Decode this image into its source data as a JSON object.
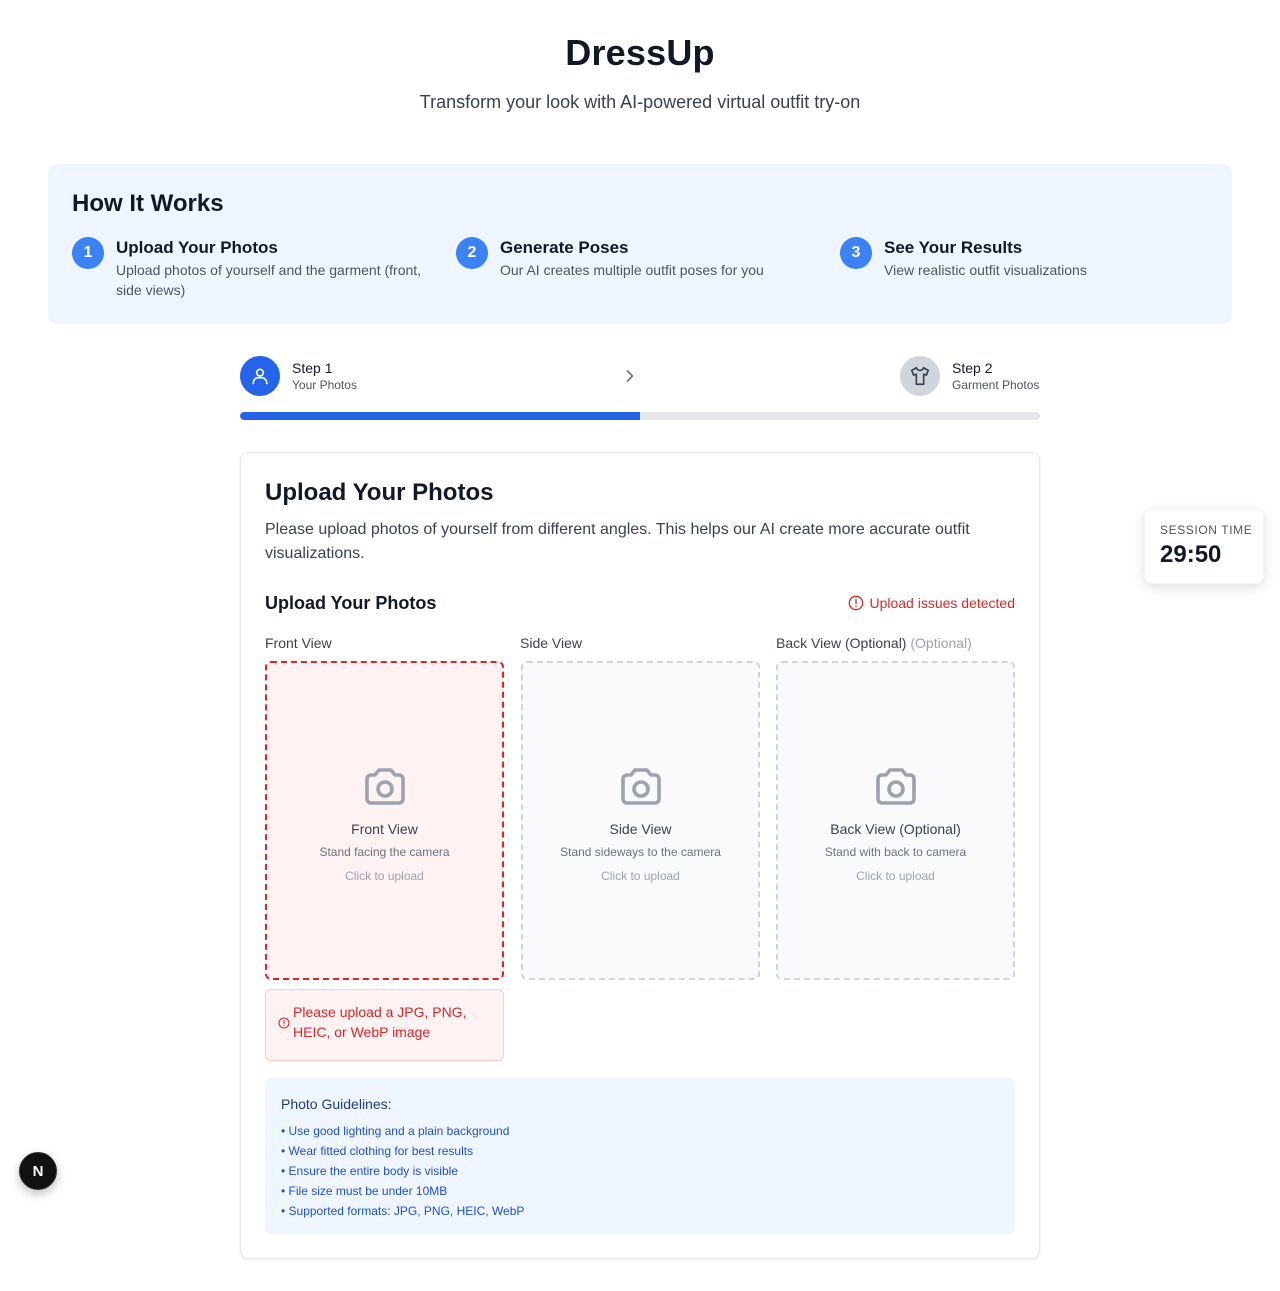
{
  "header": {
    "title": "DressUp",
    "subtitle": "Transform your look with AI-powered virtual outfit try-on"
  },
  "how_it_works": {
    "title": "How It Works",
    "steps": [
      {
        "number": "1",
        "title": "Upload Your Photos",
        "description": "Upload photos of yourself and the garment (front, side views)"
      },
      {
        "number": "2",
        "title": "Generate Poses",
        "description": "Our AI creates multiple outfit poses for you"
      },
      {
        "number": "3",
        "title": "See Your Results",
        "description": "View realistic outfit visualizations"
      }
    ]
  },
  "stepper": {
    "steps": [
      {
        "label": "Step 1",
        "sublabel": "Your Photos",
        "icon": "user-icon",
        "state": "active"
      },
      {
        "label": "Step 2",
        "sublabel": "Garment Photos",
        "icon": "shirt-icon",
        "state": "inactive"
      }
    ],
    "progress_percent": 50
  },
  "upload_card": {
    "title": "Upload Your Photos",
    "description": "Please upload photos of yourself from different angles. This helps our AI create more accurate outfit visualizations.",
    "section_title": "Upload Your Photos",
    "issues_text": "Upload issues detected",
    "slots": [
      {
        "label": "Front View",
        "optional_tag": "",
        "title": "Front View",
        "hint": "Stand facing the camera",
        "action": "Click to upload",
        "state": "error",
        "icon": "camera-icon"
      },
      {
        "label": "Side View",
        "optional_tag": "",
        "title": "Side View",
        "hint": "Stand sideways to the camera",
        "action": "Click to upload",
        "state": "empty",
        "icon": "camera-icon"
      },
      {
        "label": "Back View (Optional)",
        "optional_tag": "(Optional)",
        "title": "Back View (Optional)",
        "hint": "Stand with back to camera",
        "action": "Click to upload",
        "state": "empty",
        "icon": "camera-icon"
      }
    ],
    "error_message": "Please upload a JPG, PNG, HEIC, or WebP image",
    "guidelines": {
      "title": "Photo Guidelines:",
      "items": [
        "• Use good lighting and a plain background",
        "• Wear fitted clothing for best results",
        "• Ensure the entire body is visible",
        "• File size must be under 10MB",
        "• Supported formats: JPG, PNG, HEIC, WebP"
      ]
    }
  },
  "session": {
    "label": "SESSION TIME",
    "time": "29:50"
  },
  "dev_badge": {
    "letter": "N"
  },
  "colors": {
    "primary": "#2563eb",
    "error": "#dc2626",
    "info_bg": "#eff6ff"
  }
}
